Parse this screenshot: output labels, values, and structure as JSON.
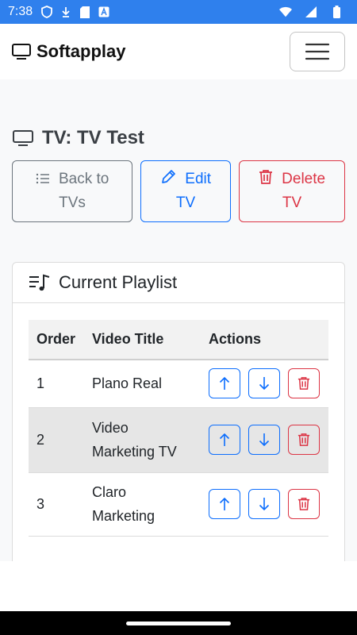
{
  "status_bar": {
    "time": "7:38"
  },
  "navbar": {
    "brand": "Softapplay"
  },
  "page": {
    "title": "TV: TV Test"
  },
  "buttons": {
    "back": {
      "line1": "Back to",
      "line2": "TVs"
    },
    "edit": {
      "line1": "Edit",
      "line2": "TV"
    },
    "delete": {
      "line1": "Delete",
      "line2": "TV"
    }
  },
  "playlist": {
    "title": "Current Playlist",
    "columns": [
      "Order",
      "Video Title",
      "Actions"
    ],
    "rows": [
      {
        "order": "1",
        "title_line1": "Plano Real",
        "title_line2": ""
      },
      {
        "order": "2",
        "title_line1": "Video",
        "title_line2": "Marketing TV"
      },
      {
        "order": "3",
        "title_line1": "Claro",
        "title_line2": "Marketing"
      }
    ]
  },
  "colors": {
    "status_bar": "#2f80ed",
    "primary": "#0d6efd",
    "danger": "#dc3545",
    "secondary": "#6c757d"
  }
}
